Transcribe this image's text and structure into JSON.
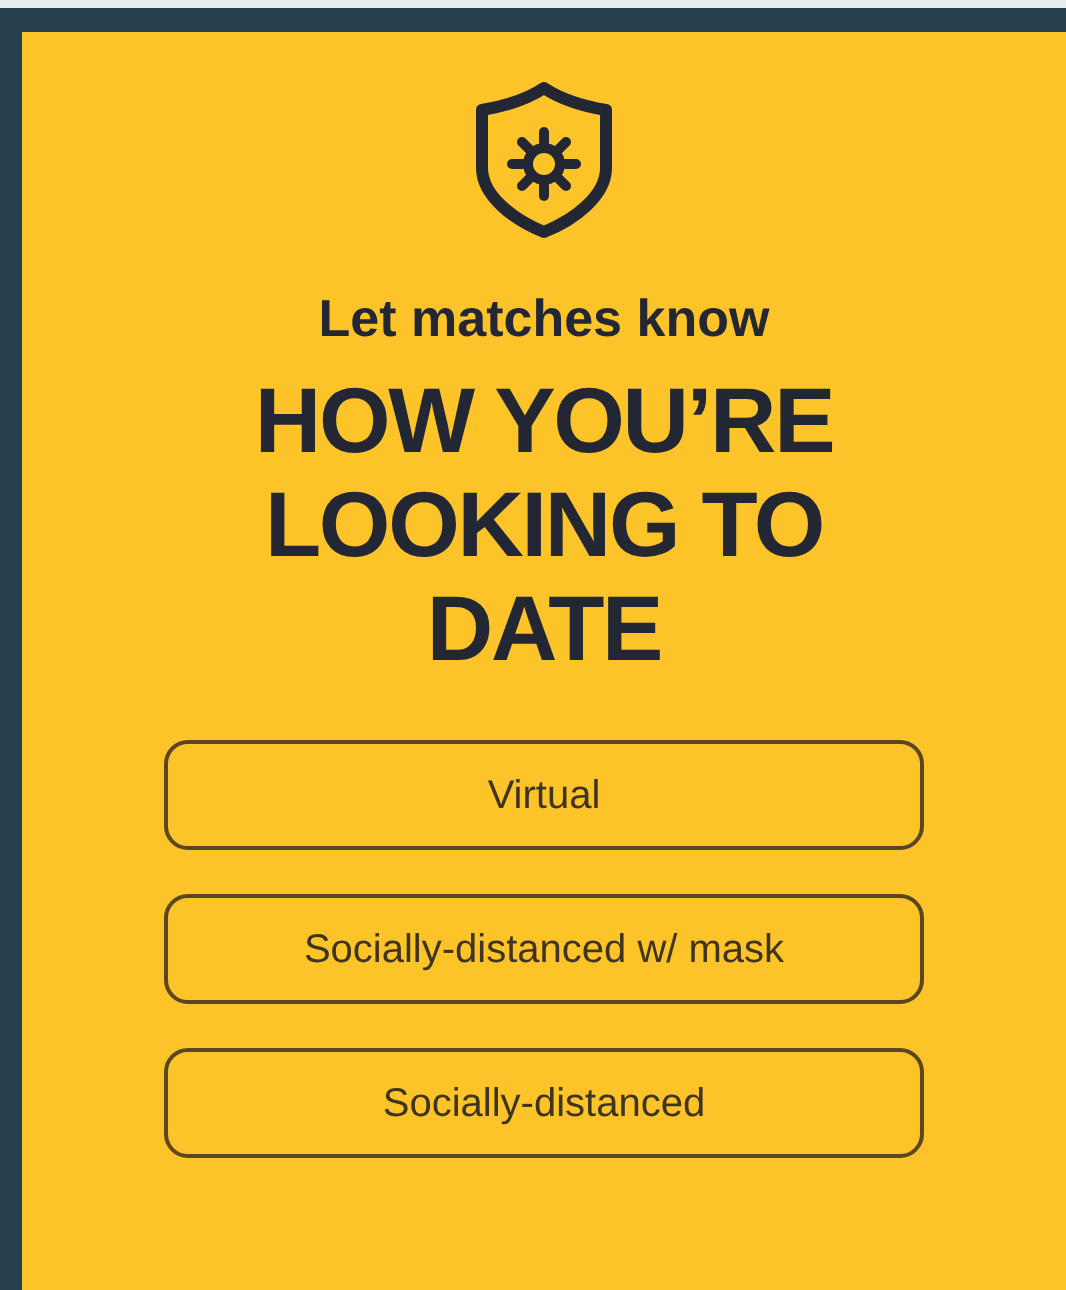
{
  "subtitle": "Let matches know",
  "headline": [
    "HOW YOU’RE",
    "LOOKING TO",
    "DATE"
  ],
  "options": [
    {
      "label": "Virtual"
    },
    {
      "label": "Socially-distanced w/ mask"
    },
    {
      "label": "Socially-distanced"
    }
  ]
}
